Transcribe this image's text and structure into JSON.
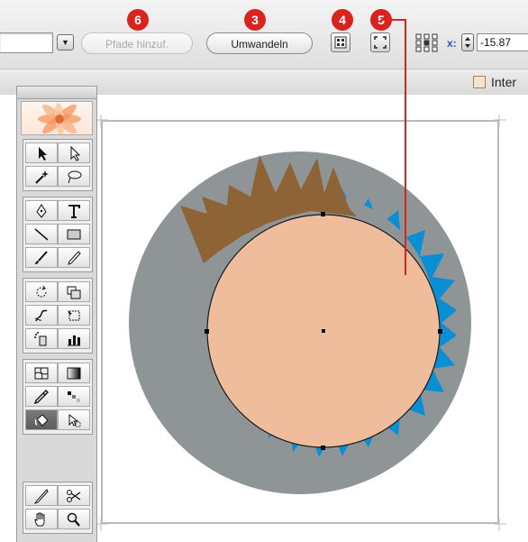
{
  "toolbar": {
    "add_paths_label": "Pfade hinzuf.",
    "convert_label": "Umwandeln",
    "x_label": "x:",
    "x_value": "-15.87"
  },
  "badges": [
    "6",
    "3",
    "4",
    "5"
  ],
  "tab": {
    "title": "Inter"
  },
  "colors": {
    "accent_badge": "#d8231f",
    "gray_ring": "#8f9597",
    "blue_star": "#0a8fd5",
    "brown_spikes": "#8e6436",
    "peach_circle": "#f0bd9c"
  },
  "tools": [
    [
      "selection-arrow-icon",
      "direct-selection-icon"
    ],
    [
      "magic-wand-icon",
      "lasso-icon"
    ],
    [
      "pen-icon",
      "type-icon"
    ],
    [
      "line-icon",
      "rectangle-icon"
    ],
    [
      "paintbrush-icon",
      "pencil-icon"
    ],
    [
      "rotate-icon",
      "scale-icon"
    ],
    [
      "warp-icon",
      "free-transform-icon"
    ],
    [
      "symbol-sprayer-icon",
      "column-graph-icon"
    ],
    [
      "mesh-icon",
      "gradient-icon"
    ],
    [
      "eyedropper-icon",
      "blend-icon"
    ],
    [
      "live-paint-bucket-icon",
      "live-paint-selection-icon"
    ],
    [
      "slice-icon",
      "scissors-icon"
    ],
    [
      "hand-icon",
      "zoom-icon"
    ]
  ]
}
